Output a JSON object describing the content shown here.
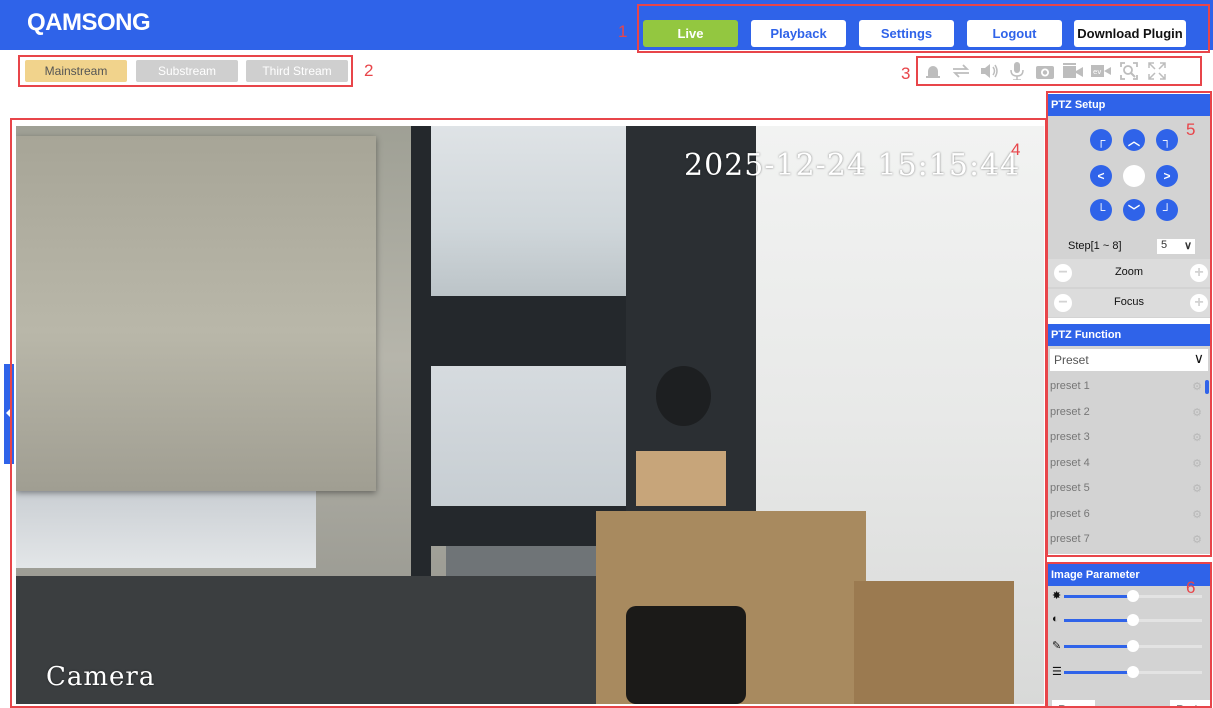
{
  "header": {
    "logo": "QAMSONG",
    "nav": [
      "Live",
      "Playback",
      "Settings",
      "Logout",
      "Download Plugin"
    ],
    "active": "Live"
  },
  "streams": {
    "tabs": [
      "Mainstream",
      "Substream",
      "Third Stream"
    ],
    "active": "Mainstream"
  },
  "toolbar": {
    "icons": [
      "alarm-icon",
      "swap-icon",
      "volume-icon",
      "microphone-icon",
      "snapshot-icon",
      "record-icon",
      "video-clip-icon",
      "digital-zoom-icon",
      "fullscreen-icon"
    ]
  },
  "video": {
    "datetime": "2025-12-24   15:15:44",
    "camera_label": "Camera"
  },
  "annotations": [
    "1",
    "2",
    "3",
    "4",
    "5",
    "6"
  ],
  "ptz_setup": {
    "title": "PTZ Setup",
    "step_label": "Step[1 ~ 8]",
    "step_value": "5",
    "zoom_label": "Zoom",
    "focus_label": "Focus"
  },
  "ptz_function": {
    "title": "PTZ Function",
    "selected": "Preset",
    "presets": [
      "preset 1",
      "preset 2",
      "preset 3",
      "preset 4",
      "preset 5",
      "preset 6",
      "preset 7"
    ]
  },
  "image_parameter": {
    "title": "Image Parameter",
    "sliders": [
      {
        "name": "brightness",
        "value": 0.5
      },
      {
        "name": "contrast",
        "value": 0.5
      },
      {
        "name": "saturation",
        "value": 0.5
      },
      {
        "name": "sharpness",
        "value": 0.5
      }
    ],
    "reset_label": "Reset",
    "ratio_label": "Ratio"
  },
  "colors": {
    "brand": "#2f63e9",
    "active_nav": "#93c740",
    "active_stream": "#f1d38c",
    "annotation": "#e8454a"
  }
}
